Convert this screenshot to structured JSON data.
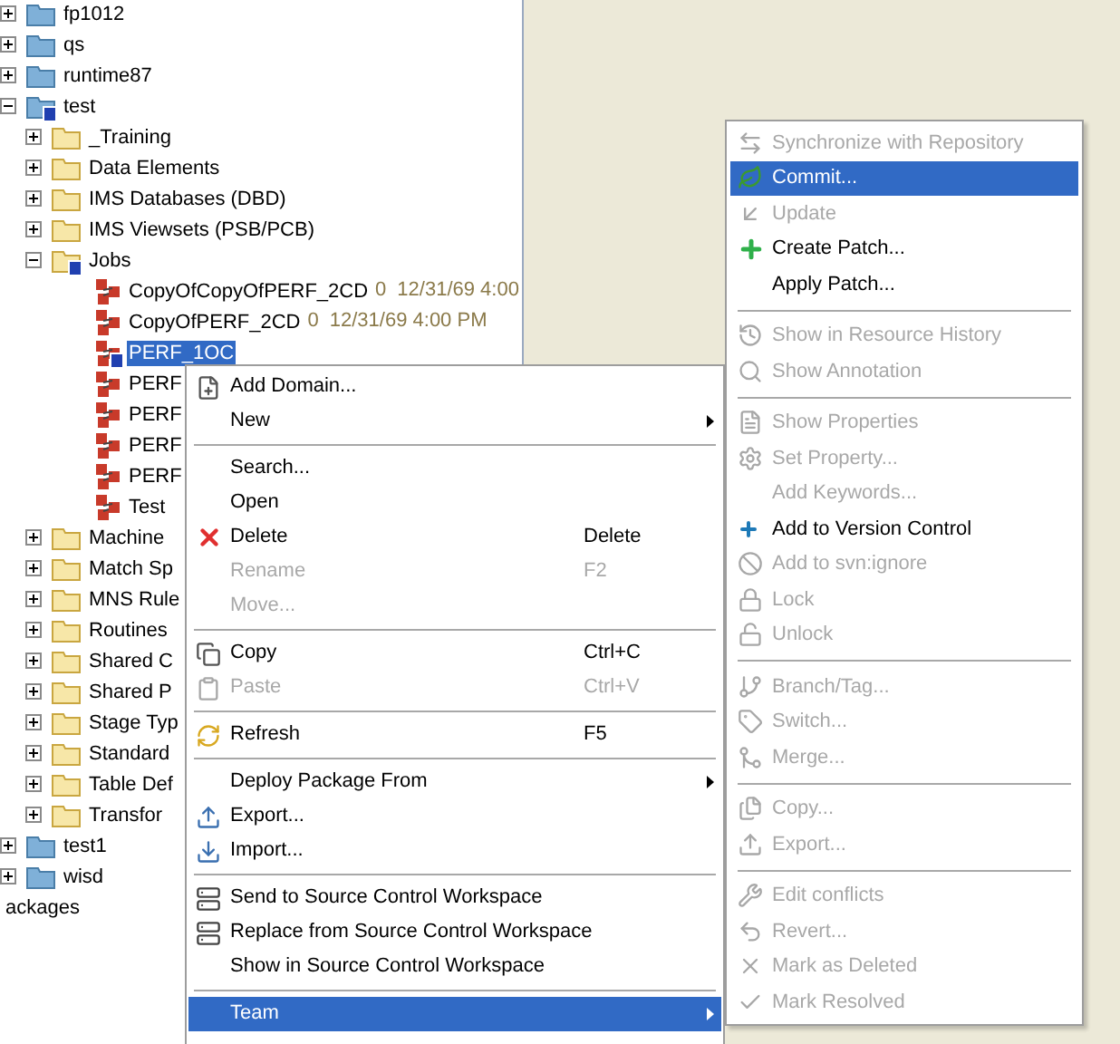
{
  "tree": [
    {
      "label": "fp1012",
      "kind": "project",
      "expanded": false,
      "selected": false,
      "unversioned": false
    },
    {
      "label": "qs",
      "kind": "project",
      "expanded": false,
      "selected": false,
      "unversioned": false
    },
    {
      "label": "runtime87",
      "kind": "project",
      "expanded": false,
      "selected": false,
      "unversioned": false
    },
    {
      "label": "test",
      "kind": "project",
      "expanded": true,
      "selected": false,
      "unversioned": true,
      "children": [
        {
          "label": "_Training",
          "kind": "folder",
          "expanded": false,
          "selected": false,
          "unversioned": false
        },
        {
          "label": "Data Elements",
          "kind": "folder",
          "expanded": false,
          "selected": false,
          "unversioned": false
        },
        {
          "label": "IMS Databases (DBD)",
          "kind": "folder",
          "expanded": false,
          "selected": false,
          "unversioned": false
        },
        {
          "label": "IMS Viewsets (PSB/PCB)",
          "kind": "folder",
          "expanded": false,
          "selected": false,
          "unversioned": false
        },
        {
          "label": "Jobs",
          "kind": "folder",
          "expanded": true,
          "selected": false,
          "unversioned": true,
          "children": [
            {
              "label": "CopyOfCopyOfPERF_2CD",
              "kind": "job",
              "selected": false,
              "unversioned": false,
              "revision": "0",
              "date": "12/31/69 4:00"
            },
            {
              "label": "CopyOfPERF_2CD",
              "kind": "job",
              "selected": false,
              "unversioned": false,
              "revision": "0",
              "date": "12/31/69 4:00 PM"
            },
            {
              "label": "PERF_1OC",
              "kind": "job",
              "selected": true,
              "unversioned": true
            },
            {
              "label": "PERF",
              "kind": "job",
              "selected": false,
              "unversioned": false
            },
            {
              "label": "PERF",
              "kind": "job",
              "selected": false,
              "unversioned": false
            },
            {
              "label": "PERF",
              "kind": "job",
              "selected": false,
              "unversioned": false
            },
            {
              "label": "PERF",
              "kind": "job",
              "selected": false,
              "unversioned": false
            },
            {
              "label": "Test",
              "kind": "job",
              "selected": false,
              "unversioned": false
            }
          ]
        },
        {
          "label": "Machine",
          "kind": "folder",
          "expanded": false,
          "selected": false,
          "unversioned": false
        },
        {
          "label": "Match Sp",
          "kind": "folder",
          "expanded": false,
          "selected": false,
          "unversioned": false
        },
        {
          "label": "MNS Rule",
          "kind": "folder",
          "expanded": false,
          "selected": false,
          "unversioned": false
        },
        {
          "label": "Routines",
          "kind": "folder",
          "expanded": false,
          "selected": false,
          "unversioned": false
        },
        {
          "label": "Shared C",
          "kind": "folder",
          "expanded": false,
          "selected": false,
          "unversioned": false
        },
        {
          "label": "Shared P",
          "kind": "folder",
          "expanded": false,
          "selected": false,
          "unversioned": false
        },
        {
          "label": "Stage Typ",
          "kind": "folder",
          "expanded": false,
          "selected": false,
          "unversioned": false
        },
        {
          "label": "Standard",
          "kind": "folder",
          "expanded": false,
          "selected": false,
          "unversioned": false
        },
        {
          "label": "Table Def",
          "kind": "folder",
          "expanded": false,
          "selected": false,
          "unversioned": false
        },
        {
          "label": "Transfor",
          "kind": "folder",
          "expanded": false,
          "selected": false,
          "unversioned": false
        }
      ]
    },
    {
      "label": "test1",
      "kind": "project",
      "expanded": false,
      "selected": false,
      "unversioned": false
    },
    {
      "label": "wisd",
      "kind": "project",
      "expanded": false,
      "selected": false,
      "unversioned": false
    },
    {
      "label": "ackages",
      "kind": "text",
      "selected": false
    }
  ],
  "context_menu": {
    "groups": [
      [
        {
          "label": "Add Domain...",
          "disabled": false,
          "selected": false,
          "submenu": false
        },
        {
          "label": "New",
          "disabled": false,
          "selected": false,
          "submenu": true
        }
      ],
      [
        {
          "label": "Search...",
          "disabled": false,
          "selected": false,
          "submenu": false
        },
        {
          "label": "Open",
          "disabled": false,
          "selected": false,
          "submenu": false
        },
        {
          "label": "Delete",
          "shortcut": "Delete",
          "disabled": false,
          "selected": false,
          "submenu": false
        },
        {
          "label": "Rename",
          "shortcut": "F2",
          "disabled": true,
          "selected": false,
          "submenu": false
        },
        {
          "label": "Move...",
          "disabled": true,
          "selected": false,
          "submenu": false
        }
      ],
      [
        {
          "label": "Copy",
          "shortcut": "Ctrl+C",
          "disabled": false,
          "selected": false,
          "submenu": false
        },
        {
          "label": "Paste",
          "shortcut": "Ctrl+V",
          "disabled": true,
          "selected": false,
          "submenu": false
        }
      ],
      [
        {
          "label": "Refresh",
          "shortcut": "F5",
          "disabled": false,
          "selected": false,
          "submenu": false
        }
      ],
      [
        {
          "label": "Deploy Package From",
          "disabled": false,
          "selected": false,
          "submenu": true
        },
        {
          "label": "Export...",
          "disabled": false,
          "selected": false,
          "submenu": false
        },
        {
          "label": "Import...",
          "disabled": false,
          "selected": false,
          "submenu": false
        }
      ],
      [
        {
          "label": "Send to Source Control Workspace",
          "disabled": false,
          "selected": false,
          "submenu": false
        },
        {
          "label": "Replace from Source Control Workspace",
          "disabled": false,
          "selected": false,
          "submenu": false
        },
        {
          "label": "Show in Source Control Workspace",
          "disabled": false,
          "selected": false,
          "submenu": false
        }
      ],
      [
        {
          "label": "Team",
          "disabled": false,
          "selected": true,
          "submenu": true
        }
      ]
    ]
  },
  "team_submenu": {
    "groups": [
      [
        {
          "label": "Synchronize with Repository",
          "disabled": true,
          "selected": false
        },
        {
          "label": "Commit...",
          "disabled": false,
          "selected": true
        },
        {
          "label": "Update",
          "disabled": true,
          "selected": false
        },
        {
          "label": "Create Patch...",
          "disabled": false,
          "selected": false
        },
        {
          "label": "Apply Patch...",
          "disabled": false,
          "selected": false
        }
      ],
      [
        {
          "label": "Show in Resource History",
          "disabled": true,
          "selected": false
        },
        {
          "label": "Show Annotation",
          "disabled": true,
          "selected": false
        }
      ],
      [
        {
          "label": "Show Properties",
          "disabled": true,
          "selected": false
        },
        {
          "label": "Set Property...",
          "disabled": true,
          "selected": false
        },
        {
          "label": "Add Keywords...",
          "disabled": true,
          "selected": false
        },
        {
          "label": "Add to Version Control",
          "disabled": false,
          "selected": false
        },
        {
          "label": "Add to svn:ignore",
          "disabled": true,
          "selected": false
        },
        {
          "label": "Lock",
          "disabled": true,
          "selected": false
        },
        {
          "label": "Unlock",
          "disabled": true,
          "selected": false
        }
      ],
      [
        {
          "label": "Branch/Tag...",
          "disabled": true,
          "selected": false
        },
        {
          "label": "Switch...",
          "disabled": true,
          "selected": false
        },
        {
          "label": "Merge...",
          "disabled": true,
          "selected": false
        }
      ],
      [
        {
          "label": "Copy...",
          "disabled": true,
          "selected": false
        },
        {
          "label": "Export...",
          "disabled": true,
          "selected": false
        }
      ],
      [
        {
          "label": "Edit conflicts",
          "disabled": true,
          "selected": false
        },
        {
          "label": "Revert...",
          "disabled": true,
          "selected": false
        },
        {
          "label": "Mark as Deleted",
          "disabled": true,
          "selected": false
        },
        {
          "label": "Mark Resolved",
          "disabled": true,
          "selected": false
        }
      ]
    ]
  }
}
